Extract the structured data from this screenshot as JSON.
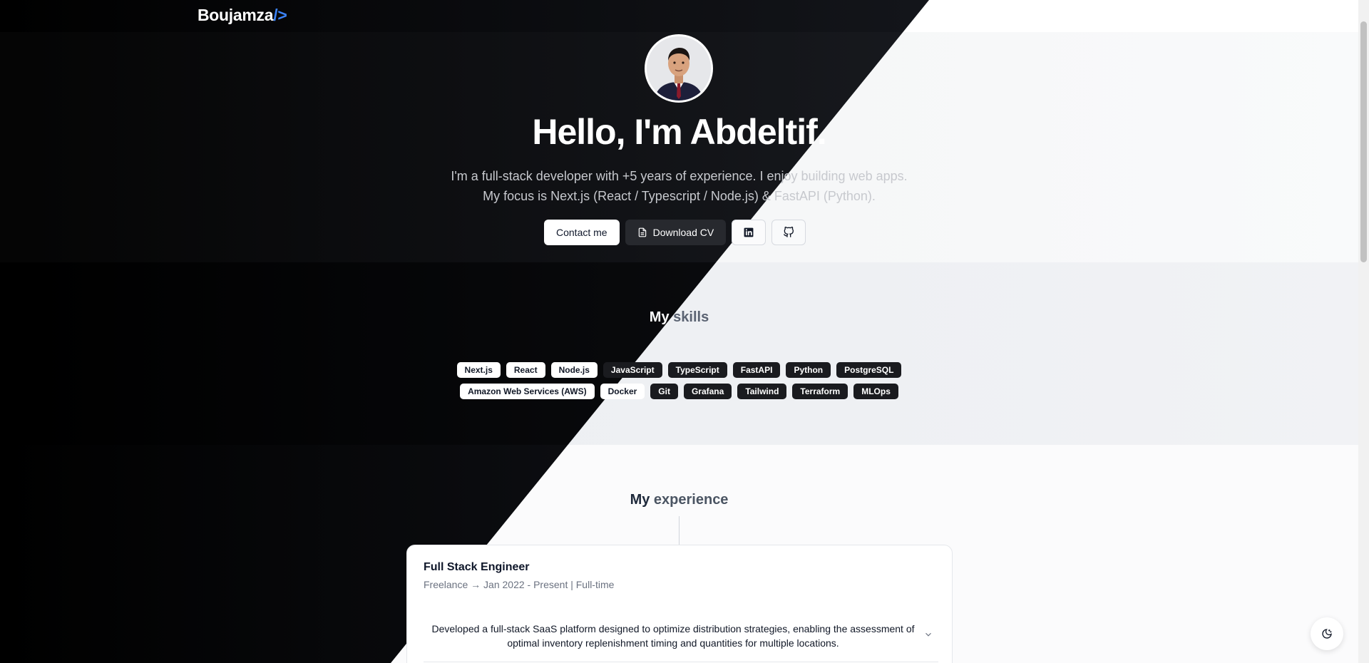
{
  "header": {
    "logo_text": "Boujamza",
    "logo_accent": "/>"
  },
  "hero": {
    "title_prefix": "Hello, ",
    "title_name": "I'm Abdeltif",
    "title_suffix": ".",
    "subtitle_line1": "I'm a full-stack developer with +5 years of experience. I enjoy building web apps.",
    "subtitle_line2": "My focus is Next.js (React / Typescript / Node.js) & FastAPI (Python).",
    "contact_label": "Contact me",
    "cv_label": "Download CV",
    "icons": [
      "document-icon",
      "linkedin-icon",
      "github-icon"
    ]
  },
  "skills": {
    "title_w1": "My",
    "title_w2": "skills",
    "items": [
      "Next.js",
      "React",
      "Node.js",
      "JavaScript",
      "TypeScript",
      "FastAPI",
      "Python",
      "PostgreSQL",
      "Amazon Web Services (AWS)",
      "Docker",
      "Git",
      "Grafana",
      "Tailwind",
      "Terraform",
      "MLOps"
    ]
  },
  "experience": {
    "title_w1": "My",
    "title_w2": "experience",
    "items": [
      {
        "role": "Full Stack Engineer",
        "meta": "Freelance → Jan 2022 - Present | Full-time",
        "description": "Developed a full-stack SaaS platform designed to optimize distribution strategies, enabling the assessment of optimal inventory replenishment timing and quantities for multiple locations."
      }
    ]
  },
  "colors": {
    "accent": "#3b82f6",
    "highlight": "#2a13d4",
    "dark_bg": "#0a0b0e",
    "light_bg": "#f4f5f7"
  },
  "theme_toggle_icon": "moon-icon"
}
